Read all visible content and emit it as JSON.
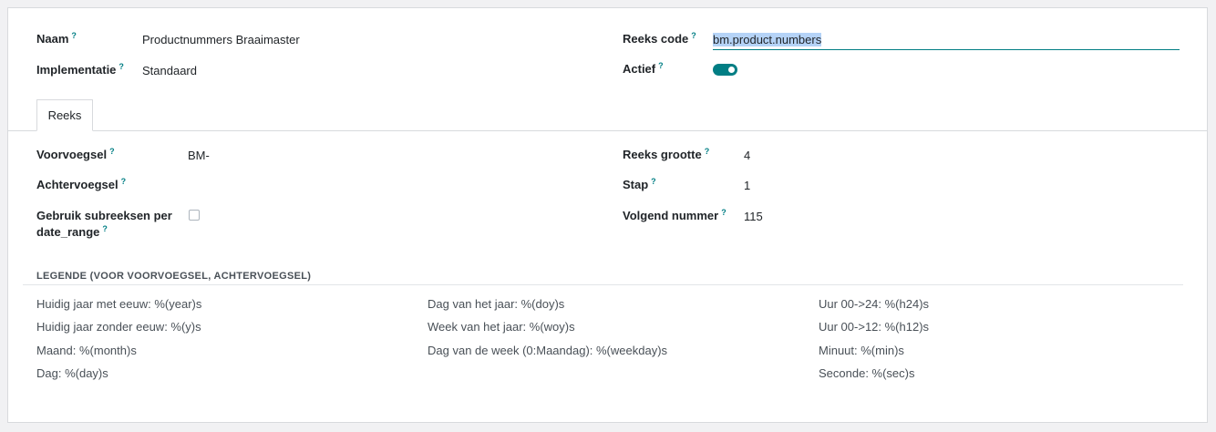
{
  "header": {
    "naam_label": "Naam",
    "naam_value": "Productnummers Braaimaster",
    "implementatie_label": "Implementatie",
    "implementatie_value": "Standaard",
    "reeks_code_label": "Reeks code",
    "reeks_code_value": "bm.product.numbers",
    "actief_label": "Actief",
    "actief_value": true,
    "help_mark": "?"
  },
  "tabs": [
    {
      "label": "Reeks",
      "active": true
    }
  ],
  "reeks": {
    "voorvoegsel_label": "Voorvoegsel",
    "voorvoegsel_value": "BM-",
    "achtervoegsel_label": "Achtervoegsel",
    "achtervoegsel_value": "",
    "subreeksen_label": "Gebruik subreeksen per date_range",
    "subreeksen_value": false,
    "grootte_label": "Reeks grootte",
    "grootte_value": "4",
    "stap_label": "Stap",
    "stap_value": "1",
    "volgend_label": "Volgend nummer",
    "volgend_value": "115"
  },
  "legend": {
    "title": "LEGENDE (VOOR VOORVOEGSEL, ACHTERVOEGSEL)",
    "col1": [
      "Huidig jaar met eeuw: %(year)s",
      "Huidig jaar zonder eeuw: %(y)s",
      "Maand: %(month)s",
      "Dag: %(day)s"
    ],
    "col2": [
      "Dag van het jaar: %(doy)s",
      "Week van het jaar: %(woy)s",
      "Dag van de week (0:Maandag): %(weekday)s"
    ],
    "col3": [
      "Uur 00->24: %(h24)s",
      "Uur 00->12: %(h12)s",
      "Minuut: %(min)s",
      "Seconde: %(sec)s"
    ]
  },
  "colors": {
    "accent": "#017e84",
    "selection": "#b5d3f7",
    "border": "#d8dadd"
  }
}
